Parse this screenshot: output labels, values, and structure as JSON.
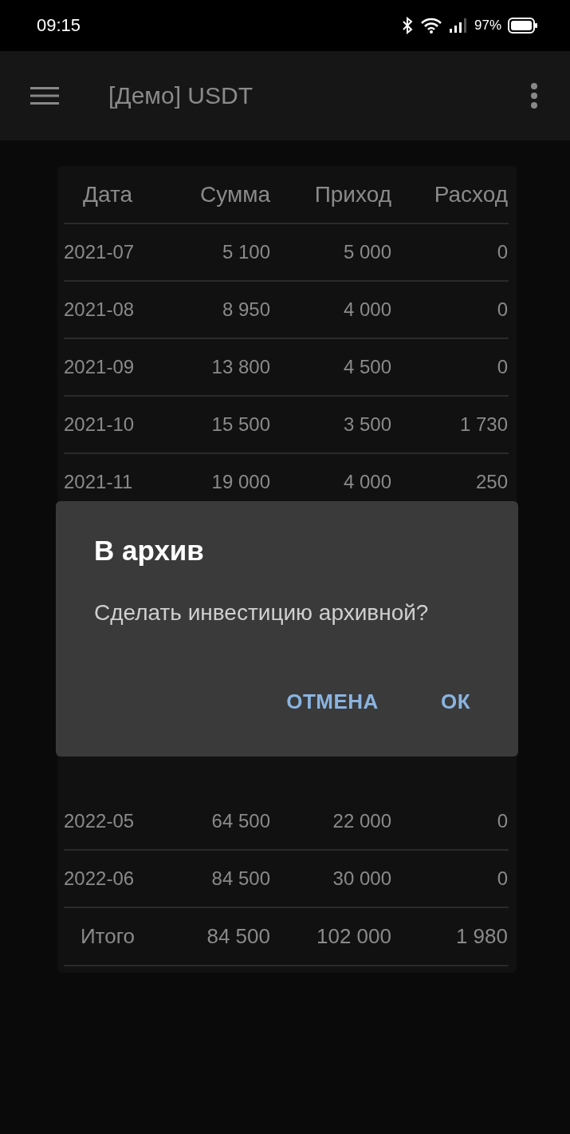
{
  "status_bar": {
    "time": "09:15",
    "battery": "97%"
  },
  "app_bar": {
    "title": "[Демо] USDT"
  },
  "table": {
    "columns": [
      "Дата",
      "Сумма",
      "Приход",
      "Расход"
    ],
    "rows_above": [
      [
        "2021-07",
        "5 100",
        "5 000",
        "0"
      ],
      [
        "2021-08",
        "8 950",
        "4 000",
        "0"
      ],
      [
        "2021-09",
        "13 800",
        "4 500",
        "0"
      ],
      [
        "2021-10",
        "15 500",
        "3 500",
        "1 730"
      ],
      [
        "2021-11",
        "19 000",
        "4 000",
        "250"
      ]
    ],
    "rows_below": [
      [
        "2022-05",
        "64 500",
        "22 000",
        "0"
      ],
      [
        "2022-06",
        "84 500",
        "30 000",
        "0"
      ]
    ],
    "total": [
      "Итого",
      "84 500",
      "102 000",
      "1 980"
    ]
  },
  "dialog": {
    "title": "В архив",
    "message": "Сделать инвестицию архивной?",
    "buttons": [
      "ОТМЕНА",
      "ОК"
    ]
  }
}
